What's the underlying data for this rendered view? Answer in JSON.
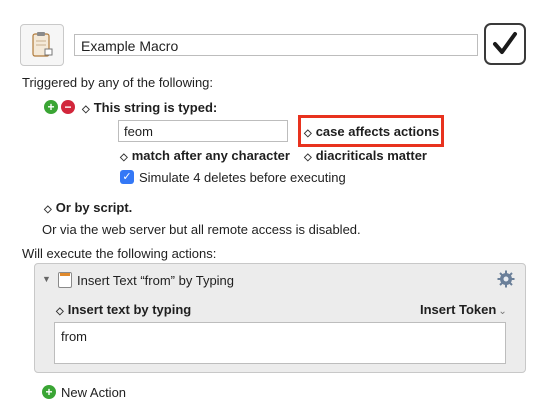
{
  "macro": {
    "name": "Example Macro",
    "icon": "clipboard-icon",
    "enabled_icon": "checkmark-icon"
  },
  "trigger": {
    "heading": "Triggered by any of the following:",
    "add_icon": "plus-icon",
    "remove_icon": "minus-icon",
    "type_label": "This string is typed:",
    "string_value": "feom",
    "case_option": "case affects actions",
    "match_option": "match after any character",
    "diacritics_option": "diacriticals matter",
    "simulate_label": "Simulate 4 deletes before executing",
    "simulate_checked": true,
    "script_label": "Or by script.",
    "web_server_note": "Or via the web server but all remote access is disabled."
  },
  "actions": {
    "heading": "Will execute the following actions:",
    "action_title": "Insert Text “from” by Typing",
    "gear_icon": "gear-icon",
    "mode_label": "Insert text by typing",
    "token_label": "Insert Token",
    "text_value": "from",
    "new_action_label": "New Action"
  },
  "colors": {
    "highlight": "#e8321e",
    "checkbox": "#3478f6",
    "add": "#3aa534",
    "remove": "#d2263b"
  }
}
